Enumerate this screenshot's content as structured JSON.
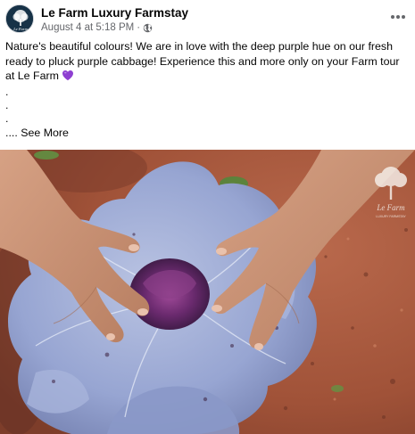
{
  "post": {
    "page_name": "Le Farm Luxury Farmstay",
    "timestamp": "August 4 at 5:18 PM",
    "separator": "·",
    "privacy_icon": "globe-icon",
    "more_icon": "more-options-icon",
    "caption": "Nature's beautiful colours! We are in love with the deep purple hue on our fresh ready to pluck purple cabbage! Experience this and more only on your Farm tour at Le Farm",
    "caption_emoji": "purple-heart-icon",
    "dot_lines": [
      ".",
      ".",
      "."
    ],
    "ellipsis": "....",
    "see_more_label": "See More"
  },
  "avatar": {
    "logo_text": "Le Farm"
  },
  "photo": {
    "subject": "hands-holding-purple-cabbage-photo",
    "watermark_text": "Le Farm",
    "watermark_tagline": "LUXURY FARMSTAY"
  },
  "colors": {
    "brand_navy": "#173247",
    "meta_gray": "#65676b",
    "heart_purple": "#8e3fd1",
    "soil": "#a8553a",
    "cabbage_leaf": "#8c9cc9"
  }
}
